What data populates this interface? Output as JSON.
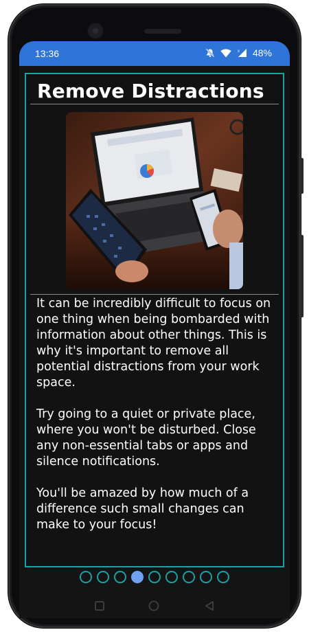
{
  "status_bar": {
    "time": "13:36",
    "icons": [
      "mute-icon",
      "wifi-icon",
      "signal-icon"
    ],
    "battery": "48%"
  },
  "page": {
    "title": "Remove Distractions",
    "image": "laptop-tablet-phone-photo",
    "paragraphs": [
      "It can be incredibly difficult to focus on one thing when being bombarded with information about other things. This is why it's important to remove all potential distractions from your work space.",
      "Try going to a quiet or private place, where you won't be disturbed. Close any non-essential tabs or apps and silence notifications.",
      "You'll be amazed by how much of a difference such small changes can make to your focus!"
    ]
  },
  "pager": {
    "total": 9,
    "current": 4
  },
  "nav": {
    "icons": [
      "recents-icon",
      "home-icon",
      "back-icon"
    ]
  },
  "colors": {
    "status_bar": "#2f74d8",
    "frame_border": "#1aa3a3",
    "active_dot": "#6ea0ee",
    "background": "#141414"
  }
}
